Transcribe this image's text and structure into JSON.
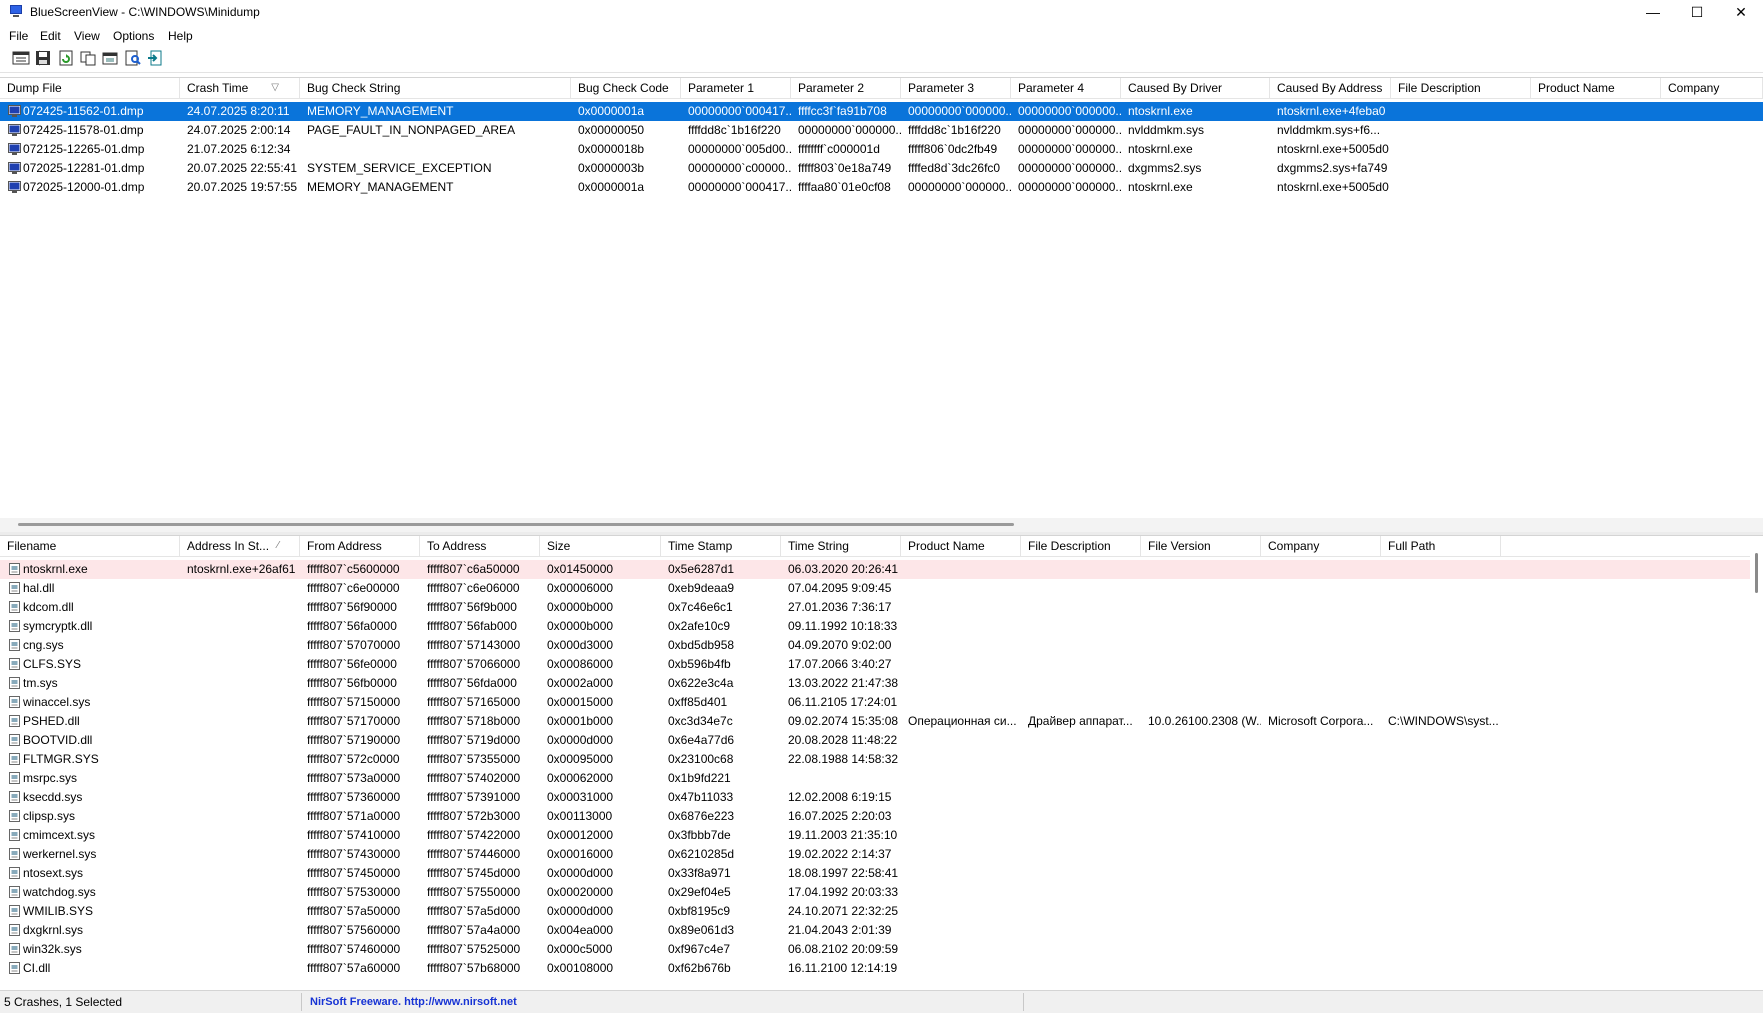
{
  "window": {
    "title": "BlueScreenView  -  C:\\WINDOWS\\Minidump",
    "minimize": "—",
    "maximize": "☐",
    "close": "✕"
  },
  "menu": [
    "File",
    "Edit",
    "View",
    "Options",
    "Help"
  ],
  "toolbar_icons": [
    "properties-window-icon",
    "save-icon",
    "refresh-icon",
    "copy-icon",
    "properties-icon",
    "find-icon",
    "exit-icon"
  ],
  "crashes": {
    "columns": [
      "Dump File",
      "Crash Time",
      "Bug Check String",
      "Bug Check Code",
      "Parameter 1",
      "Parameter 2",
      "Parameter 3",
      "Parameter 4",
      "Caused By Driver",
      "Caused By Address",
      "File Description",
      "Product Name",
      "Company"
    ],
    "sort_indicator": "▽",
    "rows": [
      [
        "072425-11562-01.dmp",
        "24.07.2025 8:20:11",
        "MEMORY_MANAGEMENT",
        "0x0000001a",
        "00000000`000417...",
        "ffffcc3f`fa91b708",
        "00000000`000000...",
        "00000000`000000...",
        "ntoskrnl.exe",
        "ntoskrnl.exe+4feba0",
        "",
        "",
        ""
      ],
      [
        "072425-11578-01.dmp",
        "24.07.2025 2:00:14",
        "PAGE_FAULT_IN_NONPAGED_AREA",
        "0x00000050",
        "ffffdd8c`1b16f220",
        "00000000`000000...",
        "ffffdd8c`1b16f220",
        "00000000`000000...",
        "nvlddmkm.sys",
        "nvlddmkm.sys+f6...",
        "",
        "",
        ""
      ],
      [
        "072125-12265-01.dmp",
        "21.07.2025 6:12:34",
        "",
        "0x0000018b",
        "00000000`005d00...",
        "ffffffff`c000001d",
        "fffff806`0dc2fb49",
        "00000000`000000...",
        "ntoskrnl.exe",
        "ntoskrnl.exe+5005d0",
        "",
        "",
        ""
      ],
      [
        "072025-12281-01.dmp",
        "20.07.2025 22:55:41",
        "SYSTEM_SERVICE_EXCEPTION",
        "0x0000003b",
        "00000000`c00000...",
        "fffff803`0e18a749",
        "ffffed8d`3dc26fc0",
        "00000000`000000...",
        "dxgmms2.sys",
        "dxgmms2.sys+fa749",
        "",
        "",
        ""
      ],
      [
        "072025-12000-01.dmp",
        "20.07.2025 19:57:55",
        "MEMORY_MANAGEMENT",
        "0x0000001a",
        "00000000`000417...",
        "ffffaa80`01e0cf08",
        "00000000`000000...",
        "00000000`000000...",
        "ntoskrnl.exe",
        "ntoskrnl.exe+5005d0",
        "",
        "",
        ""
      ]
    ],
    "selected_index": 0
  },
  "drivers": {
    "columns": [
      "Filename",
      "Address In St...",
      "From Address",
      "To Address",
      "Size",
      "Time Stamp",
      "Time String",
      "Product Name",
      "File Description",
      "File Version",
      "Company",
      "Full Path"
    ],
    "sort_indicator": "⁄",
    "rows": [
      [
        "ntoskrnl.exe",
        "ntoskrnl.exe+26af61",
        "fffff807`c5600000",
        "fffff807`c6a50000",
        "0x01450000",
        "0x5e6287d1",
        "06.03.2020 20:26:41",
        "",
        "",
        "",
        "",
        ""
      ],
      [
        "hal.dll",
        "",
        "fffff807`c6e00000",
        "fffff807`c6e06000",
        "0x00006000",
        "0xeb9deaa9",
        "07.04.2095 9:09:45",
        "",
        "",
        "",
        "",
        ""
      ],
      [
        "kdcom.dll",
        "",
        "fffff807`56f90000",
        "fffff807`56f9b000",
        "0x0000b000",
        "0x7c46e6c1",
        "27.01.2036 7:36:17",
        "",
        "",
        "",
        "",
        ""
      ],
      [
        "symcryptk.dll",
        "",
        "fffff807`56fa0000",
        "fffff807`56fab000",
        "0x0000b000",
        "0x2afe10c9",
        "09.11.1992 10:18:33",
        "",
        "",
        "",
        "",
        ""
      ],
      [
        "cng.sys",
        "",
        "fffff807`57070000",
        "fffff807`57143000",
        "0x000d3000",
        "0xbd5db958",
        "04.09.2070 9:02:00",
        "",
        "",
        "",
        "",
        ""
      ],
      [
        "CLFS.SYS",
        "",
        "fffff807`56fe0000",
        "fffff807`57066000",
        "0x00086000",
        "0xb596b4fb",
        "17.07.2066 3:40:27",
        "",
        "",
        "",
        "",
        ""
      ],
      [
        "tm.sys",
        "",
        "fffff807`56fb0000",
        "fffff807`56fda000",
        "0x0002a000",
        "0x622e3c4a",
        "13.03.2022 21:47:38",
        "",
        "",
        "",
        "",
        ""
      ],
      [
        "winaccel.sys",
        "",
        "fffff807`57150000",
        "fffff807`57165000",
        "0x00015000",
        "0xff85d401",
        "06.11.2105 17:24:01",
        "",
        "",
        "",
        "",
        ""
      ],
      [
        "PSHED.dll",
        "",
        "fffff807`57170000",
        "fffff807`5718b000",
        "0x0001b000",
        "0xc3d34e7c",
        "09.02.2074 15:35:08",
        "Операционная си...",
        "Драйвер аппарат...",
        "10.0.26100.2308 (W...",
        "Microsoft Corpora...",
        "C:\\WINDOWS\\syst..."
      ],
      [
        "BOOTVID.dll",
        "",
        "fffff807`57190000",
        "fffff807`5719d000",
        "0x0000d000",
        "0x6e4a77d6",
        "20.08.2028 11:48:22",
        "",
        "",
        "",
        "",
        ""
      ],
      [
        "FLTMGR.SYS",
        "",
        "fffff807`572c0000",
        "fffff807`57355000",
        "0x00095000",
        "0x23100c68",
        "22.08.1988 14:58:32",
        "",
        "",
        "",
        "",
        ""
      ],
      [
        "msrpc.sys",
        "",
        "fffff807`573a0000",
        "fffff807`57402000",
        "0x00062000",
        "0x1b9fd221",
        "",
        "",
        "",
        "",
        "",
        ""
      ],
      [
        "ksecdd.sys",
        "",
        "fffff807`57360000",
        "fffff807`57391000",
        "0x00031000",
        "0x47b11033",
        "12.02.2008 6:19:15",
        "",
        "",
        "",
        "",
        ""
      ],
      [
        "clipsp.sys",
        "",
        "fffff807`571a0000",
        "fffff807`572b3000",
        "0x00113000",
        "0x6876e223",
        "16.07.2025 2:20:03",
        "",
        "",
        "",
        "",
        ""
      ],
      [
        "cmimcext.sys",
        "",
        "fffff807`57410000",
        "fffff807`57422000",
        "0x00012000",
        "0x3fbbb7de",
        "19.11.2003 21:35:10",
        "",
        "",
        "",
        "",
        ""
      ],
      [
        "werkernel.sys",
        "",
        "fffff807`57430000",
        "fffff807`57446000",
        "0x00016000",
        "0x6210285d",
        "19.02.2022 2:14:37",
        "",
        "",
        "",
        "",
        ""
      ],
      [
        "ntosext.sys",
        "",
        "fffff807`57450000",
        "fffff807`5745d000",
        "0x0000d000",
        "0x33f8a971",
        "18.08.1997 22:58:41",
        "",
        "",
        "",
        "",
        ""
      ],
      [
        "watchdog.sys",
        "",
        "fffff807`57530000",
        "fffff807`57550000",
        "0x00020000",
        "0x29ef04e5",
        "17.04.1992 20:03:33",
        "",
        "",
        "",
        "",
        ""
      ],
      [
        "WMILIB.SYS",
        "",
        "fffff807`57a50000",
        "fffff807`57a5d000",
        "0x0000d000",
        "0xbf8195c9",
        "24.10.2071 22:32:25",
        "",
        "",
        "",
        "",
        ""
      ],
      [
        "dxgkrnl.sys",
        "",
        "fffff807`57560000",
        "fffff807`57a4a000",
        "0x004ea000",
        "0x89e061d3",
        "21.04.2043 2:01:39",
        "",
        "",
        "",
        "",
        ""
      ],
      [
        "win32k.sys",
        "",
        "fffff807`57460000",
        "fffff807`57525000",
        "0x000c5000",
        "0xf967c4e7",
        "06.08.2102 20:09:59",
        "",
        "",
        "",
        "",
        ""
      ],
      [
        "CI.dll",
        "",
        "fffff807`57a60000",
        "fffff807`57b68000",
        "0x00108000",
        "0xf62b676b",
        "16.11.2100 12:14:19",
        "",
        "",
        "",
        "",
        ""
      ]
    ],
    "highlighted_index": 0
  },
  "status": {
    "summary": "5 Crashes, 1 Selected",
    "nirsoft": "NirSoft Freeware.  http://www.nirsoft.net"
  },
  "colors": {
    "selection": "#0a74da",
    "error_row": "#fde6e8",
    "nirsoft_link": "#1733d4"
  }
}
